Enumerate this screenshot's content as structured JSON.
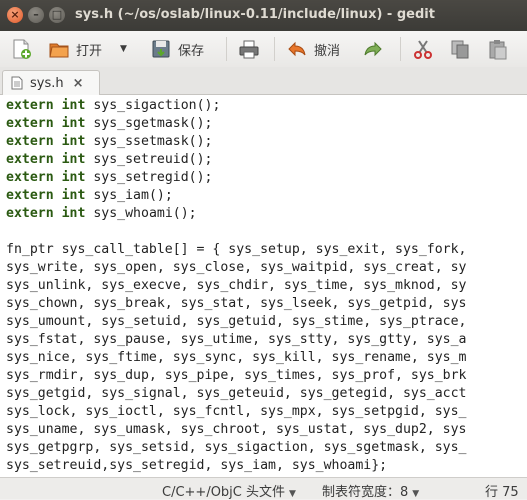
{
  "window": {
    "title": "sys.h (~/os/oslab/linux-0.11/include/linux) - gedit"
  },
  "toolbar": {
    "open_label": "打开",
    "save_label": "保存",
    "undo_label": "撤消"
  },
  "tab": {
    "label": "sys.h",
    "close": "×"
  },
  "editor": {
    "lines": [
      {
        "kw1": "extern",
        "kw2": "int",
        "rest": " sys_sigaction();"
      },
      {
        "kw1": "extern",
        "kw2": "int",
        "rest": " sys_sgetmask();"
      },
      {
        "kw1": "extern",
        "kw2": "int",
        "rest": " sys_ssetmask();"
      },
      {
        "kw1": "extern",
        "kw2": "int",
        "rest": " sys_setreuid();"
      },
      {
        "kw1": "extern",
        "kw2": "int",
        "rest": " sys_setregid();"
      },
      {
        "kw1": "extern",
        "kw2": "int",
        "rest": " sys_iam();"
      },
      {
        "kw1": "extern",
        "kw2": "int",
        "rest": " sys_whoami();"
      },
      {
        "rest": ""
      },
      {
        "rest": "fn_ptr sys_call_table[] = { sys_setup, sys_exit, sys_fork,"
      },
      {
        "rest": "sys_write, sys_open, sys_close, sys_waitpid, sys_creat, sy"
      },
      {
        "rest": "sys_unlink, sys_execve, sys_chdir, sys_time, sys_mknod, sy"
      },
      {
        "rest": "sys_chown, sys_break, sys_stat, sys_lseek, sys_getpid, sys"
      },
      {
        "rest": "sys_umount, sys_setuid, sys_getuid, sys_stime, sys_ptrace,"
      },
      {
        "rest": "sys_fstat, sys_pause, sys_utime, sys_stty, sys_gtty, sys_a"
      },
      {
        "rest": "sys_nice, sys_ftime, sys_sync, sys_kill, sys_rename, sys_m"
      },
      {
        "rest": "sys_rmdir, sys_dup, sys_pipe, sys_times, sys_prof, sys_brk"
      },
      {
        "rest": "sys_getgid, sys_signal, sys_geteuid, sys_getegid, sys_acct"
      },
      {
        "rest": "sys_lock, sys_ioctl, sys_fcntl, sys_mpx, sys_setpgid, sys_"
      },
      {
        "rest": "sys_uname, sys_umask, sys_chroot, sys_ustat, sys_dup2, sys"
      },
      {
        "rest": "sys_getpgrp, sys_setsid, sys_sigaction, sys_sgetmask, sys_"
      },
      {
        "rest": "sys_setreuid,sys_setregid, sys_iam, sys_whoami};"
      }
    ]
  },
  "statusbar": {
    "language": "C/C++/ObjC 头文件",
    "tab_width": "制表符宽度：8",
    "position": "行 75"
  }
}
